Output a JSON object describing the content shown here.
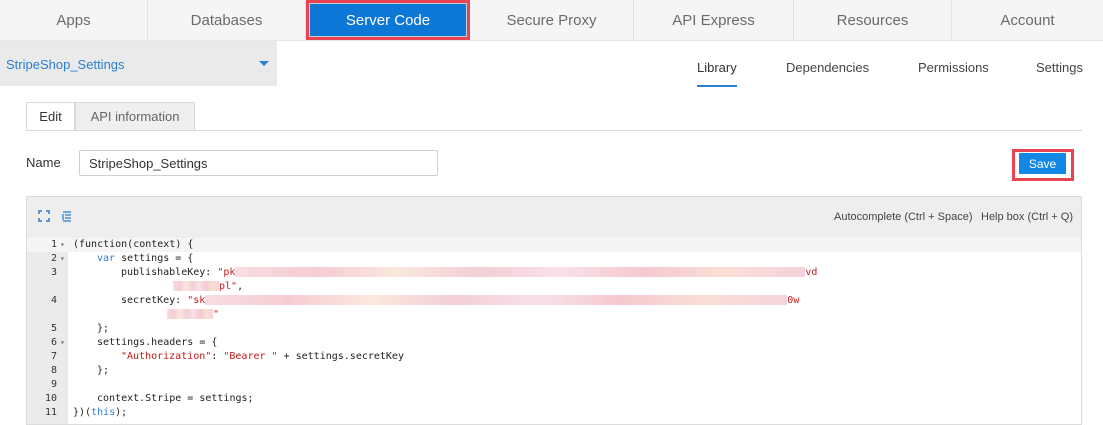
{
  "top_nav": {
    "tabs": [
      {
        "label": "Apps"
      },
      {
        "label": "Databases"
      },
      {
        "label": "Server Code",
        "active": true
      },
      {
        "label": "Secure Proxy"
      },
      {
        "label": "API Express"
      },
      {
        "label": "Resources"
      },
      {
        "label": "Account"
      }
    ]
  },
  "library_selector": {
    "value": "StripeShop_Settings"
  },
  "sub_tabs": [
    {
      "label": "Library",
      "active": true
    },
    {
      "label": "Dependencies"
    },
    {
      "label": "Permissions"
    },
    {
      "label": "Settings"
    }
  ],
  "edit_tabs": [
    {
      "label": "Edit",
      "active": true
    },
    {
      "label": "API information"
    }
  ],
  "form": {
    "name_label": "Name",
    "name_value": "StripeShop_Settings",
    "save_label": "Save"
  },
  "editor": {
    "toolbar": {
      "autocomplete_hint": "Autocomplete (Ctrl + Space)",
      "helpbox_hint": "Help box (Ctrl + Q)"
    },
    "code_lines": [
      {
        "n": "1",
        "text": "(function(context) {"
      },
      {
        "n": "2",
        "text": "var settings = {"
      },
      {
        "n": "3",
        "text": "publishableKey: \"pk"
      },
      {
        "n": "",
        "text": "pl\","
      },
      {
        "n": "4",
        "text": "secretKey: \"sk"
      },
      {
        "n": "",
        "text": "\""
      },
      {
        "n": "5",
        "text": "};"
      },
      {
        "n": "6",
        "text": "settings.headers = {"
      },
      {
        "n": "7",
        "text": "\"Authorization\": \"Bearer \" + settings.secretKey"
      },
      {
        "n": "8",
        "text": "};"
      },
      {
        "n": "9",
        "text": ""
      },
      {
        "n": "10",
        "text": "context.Stripe = settings;"
      },
      {
        "n": "11",
        "text": "})(this);"
      }
    ],
    "line3_tail": "vd",
    "line4_tail": "0w"
  },
  "colors": {
    "accent": "#0d77d6",
    "highlight_outline": "#e94452",
    "link": "#2b7fd1"
  }
}
